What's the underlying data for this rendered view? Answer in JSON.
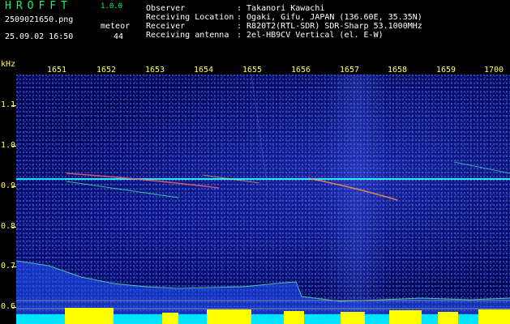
{
  "app": {
    "name": "HROFFT",
    "version": "1.0.0",
    "file": "2509021650.png",
    "stamp": "25.09.02 16:50"
  },
  "meteor": {
    "label": "meteor",
    "count": "44"
  },
  "info": [
    {
      "label": "Observer",
      "value": ": Takanori Kawachi"
    },
    {
      "label": "Receiving Location",
      "value": ": Ogaki, Gifu, JAPAN (136.60E, 35.35N)"
    },
    {
      "label": "Receiver",
      "value": ": R820T2(RTL-SDR) SDR-Sharp 53.1000MHz"
    },
    {
      "label": "Receiving antenna",
      "value": ": 2el-HB9CV Vertical (el. E-W)"
    }
  ],
  "axis": {
    "unit": "kHz",
    "time_ticks": [
      "1651",
      "1652",
      "1653",
      "1654",
      "1655",
      "1656",
      "1657",
      "1658",
      "1659",
      "1700"
    ],
    "freq_ticks": [
      "1.1",
      "1.0",
      "0.9",
      "0.8",
      "0.7",
      "0.6"
    ]
  },
  "colors": {
    "accent": "#00ff66",
    "tick": "#ffff66",
    "carrier": "#00ffff",
    "background": "#000658"
  }
}
